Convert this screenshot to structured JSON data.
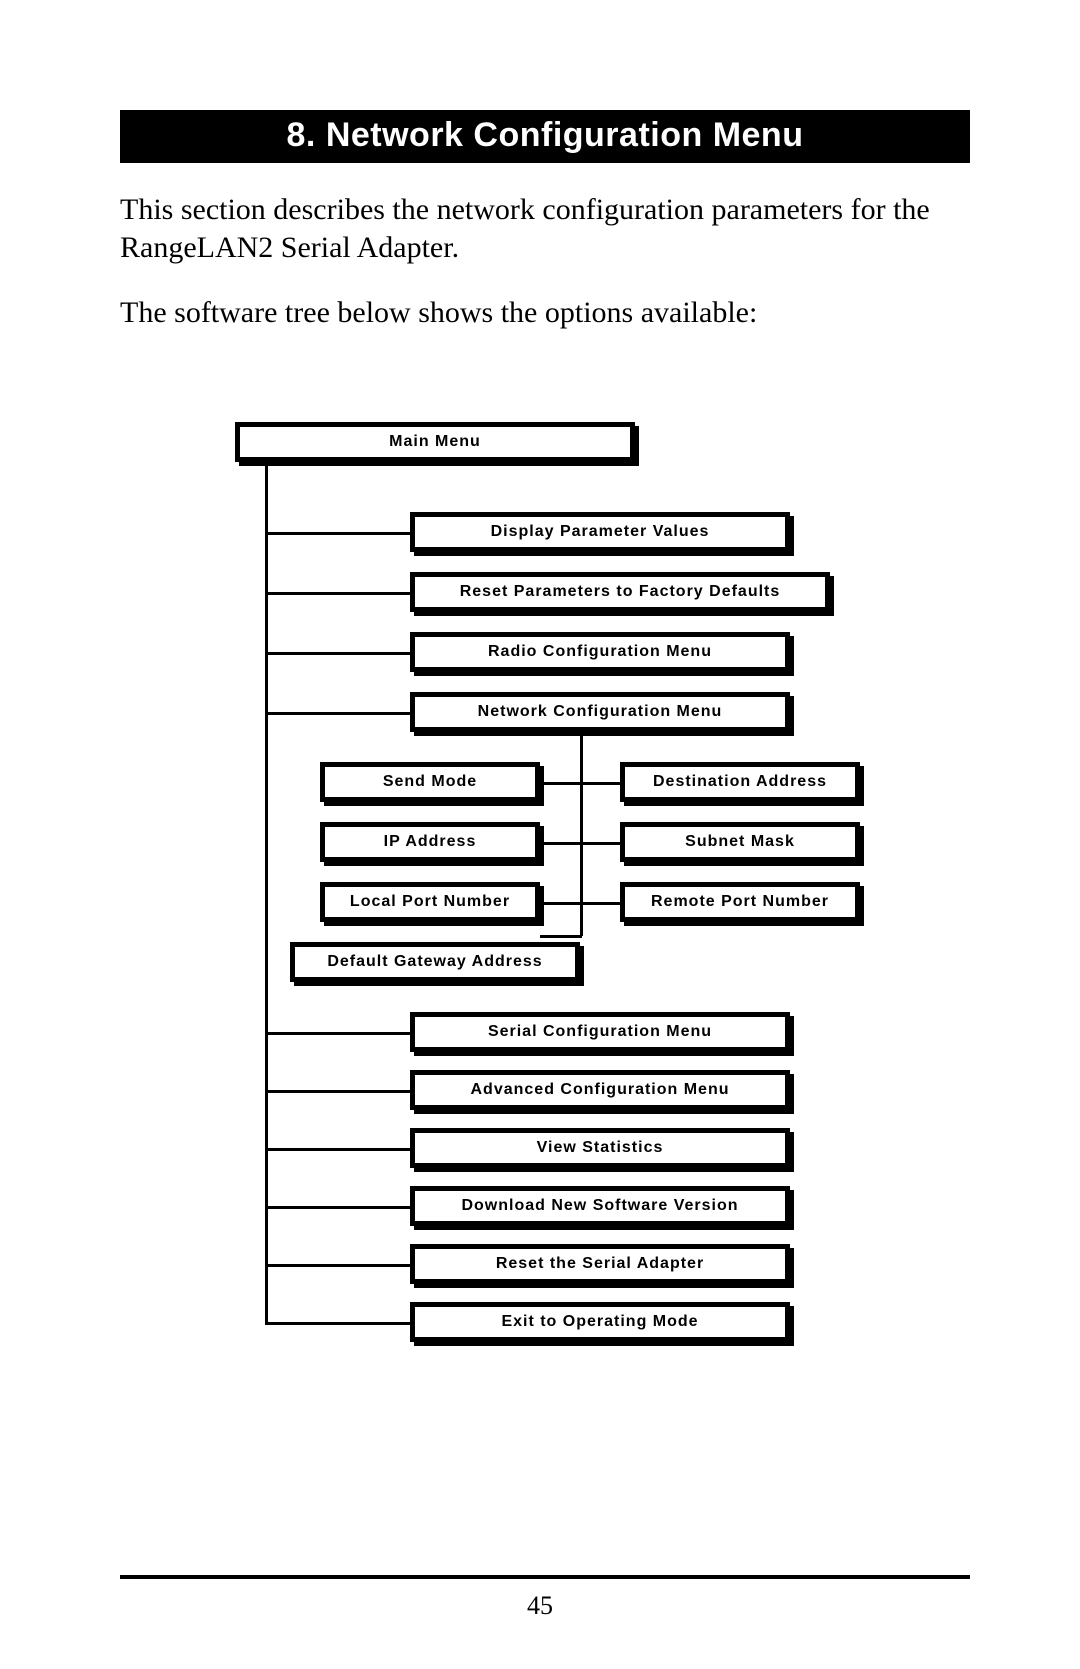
{
  "title": "8. Network Configuration Menu",
  "para1": "This section describes the network configuration parameters for the RangeLAN2 Serial Adapter.",
  "para2": "The software tree below shows the options available:",
  "tree": {
    "main": "Main Menu",
    "items": {
      "display_params": "Display Parameter Values",
      "reset_factory": "Reset Parameters to Factory Defaults",
      "radio_config": "Radio Configuration Menu",
      "network_config": "Network Configuration Menu",
      "serial_config": "Serial Configuration Menu",
      "advanced_config": "Advanced Configuration Menu",
      "view_stats": "View Statistics",
      "download_sw": "Download New Software Version",
      "reset_adapter": "Reset the Serial Adapter",
      "exit_op": "Exit to Operating Mode"
    },
    "network_sub": {
      "send_mode": "Send Mode",
      "dest_addr": "Destination Address",
      "ip_addr": "IP Address",
      "subnet": "Subnet Mask",
      "local_port": "Local Port Number",
      "remote_port": "Remote Port Number",
      "gateway": "Default Gateway Address"
    }
  },
  "page_number": "45"
}
